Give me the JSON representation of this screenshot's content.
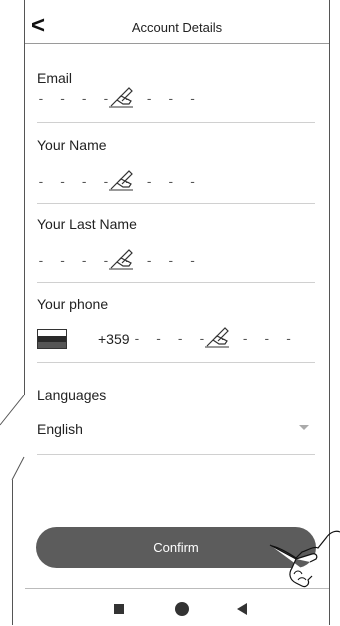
{
  "header": {
    "back_icon": "chevron-left-icon",
    "back_glyph": "<",
    "title": "Account Details"
  },
  "form": {
    "email": {
      "label": "Email",
      "placeholder": "- - - - - - - -",
      "icon": "pen-hand-icon"
    },
    "name": {
      "label": "Your Name",
      "placeholder": "- - - - - - - -",
      "icon": "pen-hand-icon"
    },
    "last_name": {
      "label": "Your Last Name",
      "placeholder": "- - - - - - - -",
      "icon": "pen-hand-icon"
    },
    "phone": {
      "label": "Your phone",
      "flag_icon": "country-flag-icon",
      "prefix": "+359",
      "placeholder": "- - - - - - - -",
      "icon": "pen-hand-icon"
    },
    "languages": {
      "label": "Languages",
      "selected": "English",
      "icon": "chevron-down-icon"
    }
  },
  "confirm_label": "Confirm",
  "nav": {
    "recents_icon": "square-icon",
    "home_icon": "circle-icon",
    "back_icon": "triangle-back-icon"
  },
  "colors": {
    "button": "#5c5c5c",
    "divider": "#d0d0d0"
  }
}
